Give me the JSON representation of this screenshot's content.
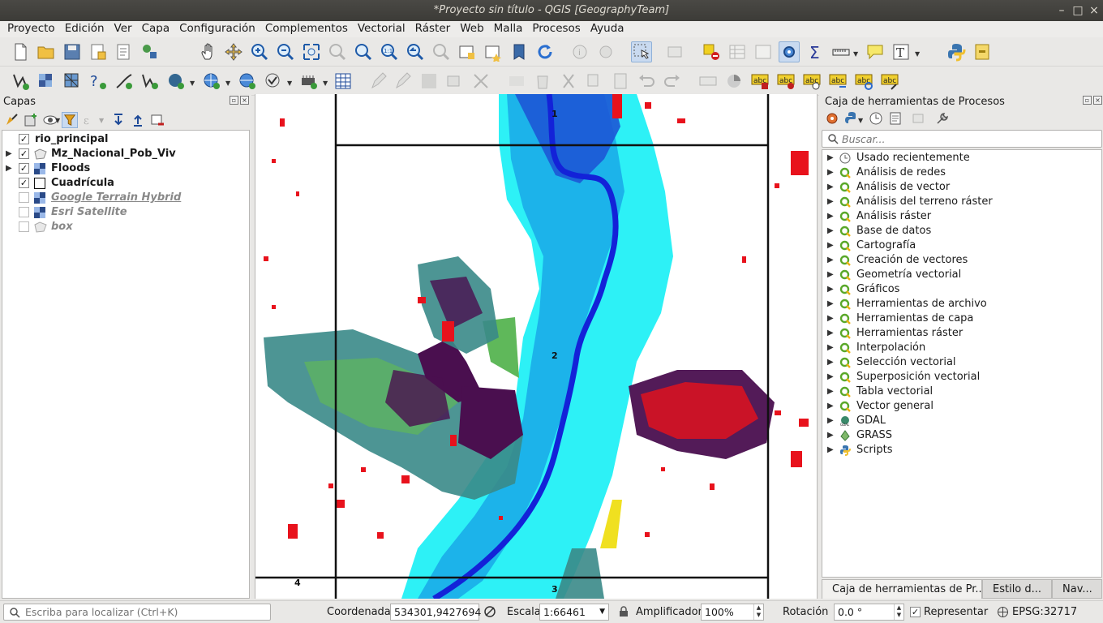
{
  "window": {
    "title": "*Proyecto sin título - QGIS [GeographyTeam]"
  },
  "menu": [
    "Proyecto",
    "Edición",
    "Ver",
    "Capa",
    "Configuración",
    "Complementos",
    "Vectorial",
    "Ráster",
    "Web",
    "Malla",
    "Procesos",
    "Ayuda"
  ],
  "layers_panel": {
    "title": "Capas",
    "layers": [
      {
        "name": "rio_principal",
        "checked": true,
        "expandable": false,
        "icon": "line-layer-icon",
        "visible_style": "bold"
      },
      {
        "name": "Mz_Nacional_Pob_Viv",
        "checked": true,
        "expandable": true,
        "icon": "polygon-layer-icon",
        "visible_style": "bold"
      },
      {
        "name": "Floods",
        "checked": true,
        "expandable": true,
        "icon": "raster-layer-icon",
        "visible_style": "bold"
      },
      {
        "name": "Cuadrícula",
        "checked": true,
        "expandable": false,
        "icon": "grid-layer-icon",
        "visible_style": "bold"
      },
      {
        "name": "Google Terrain Hybrid",
        "checked": false,
        "expandable": false,
        "icon": "raster-layer-icon",
        "visible_style": "dim-underline"
      },
      {
        "name": "Esri Satellite",
        "checked": false,
        "expandable": false,
        "icon": "raster-layer-icon",
        "visible_style": "dim"
      },
      {
        "name": "box",
        "checked": false,
        "expandable": false,
        "icon": "polygon-layer-icon",
        "visible_style": "dim"
      }
    ]
  },
  "map": {
    "grid_labels": [
      "1",
      "2",
      "3",
      "4"
    ],
    "colors": {
      "river": "#1322d8",
      "flood_light": "#22f0f5",
      "flood_mid": "#1aa8e8",
      "urban_dark": "#4a0f4f",
      "urban_teal": "#3a8a88",
      "urban_green": "#5fb85a",
      "red_points": "#e8121c"
    }
  },
  "processing_panel": {
    "title": "Caja de herramientas de Procesos",
    "search_placeholder": "Buscar...",
    "items": [
      {
        "label": "Usado recientemente",
        "icon": "clock-icon"
      },
      {
        "label": "Análisis de redes",
        "icon": "qgis-icon"
      },
      {
        "label": "Análisis de vector",
        "icon": "qgis-icon"
      },
      {
        "label": "Análisis del terreno ráster",
        "icon": "qgis-icon"
      },
      {
        "label": "Análisis ráster",
        "icon": "qgis-icon"
      },
      {
        "label": "Base de datos",
        "icon": "qgis-icon"
      },
      {
        "label": "Cartografía",
        "icon": "qgis-icon"
      },
      {
        "label": "Creación de vectores",
        "icon": "qgis-icon"
      },
      {
        "label": "Geometría vectorial",
        "icon": "qgis-icon"
      },
      {
        "label": "Gráficos",
        "icon": "qgis-icon"
      },
      {
        "label": "Herramientas de archivo",
        "icon": "qgis-icon"
      },
      {
        "label": "Herramientas de capa",
        "icon": "qgis-icon"
      },
      {
        "label": "Herramientas ráster",
        "icon": "qgis-icon"
      },
      {
        "label": "Interpolación",
        "icon": "qgis-icon"
      },
      {
        "label": "Selección vectorial",
        "icon": "qgis-icon"
      },
      {
        "label": "Superposición vectorial",
        "icon": "qgis-icon"
      },
      {
        "label": "Tabla vectorial",
        "icon": "qgis-icon"
      },
      {
        "label": "Vector general",
        "icon": "qgis-icon"
      },
      {
        "label": "GDAL",
        "icon": "gdal-icon"
      },
      {
        "label": "GRASS",
        "icon": "grass-icon"
      },
      {
        "label": "Scripts",
        "icon": "python-icon"
      }
    ],
    "tabs": [
      "Caja de herramientas de Pr...",
      "Estilo d...",
      "Nav..."
    ]
  },
  "statusbar": {
    "locator_placeholder": "Escriba para localizar (Ctrl+K)",
    "coord_label": "Coordenada",
    "coord_value": "534301,9427694",
    "scale_label": "Escala",
    "scale_value": "1:66461",
    "magnifier_label": "Amplificador",
    "magnifier_value": "100%",
    "rotation_label": "Rotación",
    "rotation_value": "0.0 °",
    "render_label": "Representar",
    "render_checked": true,
    "crs": "EPSG:32717"
  }
}
